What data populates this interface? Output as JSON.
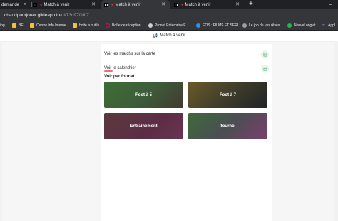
{
  "browser": {
    "tabs": [
      {
        "label": "demande",
        "active": false
      },
      {
        "label": "Match à venir",
        "active": false
      },
      {
        "label": "Match à venir",
        "active": true
      },
      {
        "label": "Match à venir",
        "active": false
      }
    ],
    "new_tab": "+",
    "window_controls": {
      "minimize": "–"
    },
    "url": {
      "domain": "chaudpourjouer.glideapp.io",
      "path": "/dl/73d97f/dl/7"
    },
    "bookmarks": [
      {
        "label": "ing",
        "icon": "folder-icon"
      },
      {
        "label": "BEL",
        "icon": "folder-icon"
      },
      {
        "label": "Centre Info Interne",
        "icon": "folder-icon"
      },
      {
        "label": "boite a outils",
        "icon": "folder-icon"
      },
      {
        "label": "Boîte de réception...",
        "icon": "mail-icon"
      },
      {
        "label": "Pronet Enterprise E...",
        "icon": "site-icon"
      },
      {
        "label": "EOS : FILMS ET SÉRI...",
        "icon": "site-icon"
      },
      {
        "label": "Le job de vos rêves...",
        "icon": "site-icon"
      },
      {
        "label": "Nouvel onglet",
        "icon": "spotify-icon"
      },
      {
        "label": "Appl",
        "icon": "apps-icon"
      }
    ]
  },
  "app": {
    "header_title": "Match à venir",
    "rows": {
      "map": "Voir les matchs sur la carte",
      "calendar": "Voir le calendrier"
    },
    "section_title": "Voir par format",
    "tiles": [
      "Foot à 5",
      "Foot à 7",
      "Entrainement",
      "Tournoi"
    ]
  },
  "colors": {
    "accent_underline": "#e57373",
    "row_button_bg": "#e7f4ec",
    "row_button_icon": "#3aa36a"
  }
}
